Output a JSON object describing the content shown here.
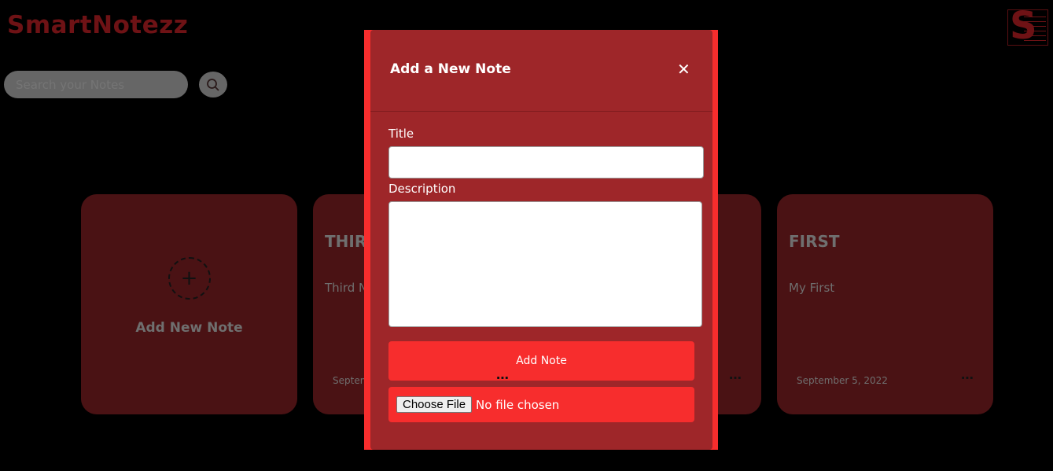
{
  "header": {
    "brand": "SmartNotezz",
    "logo_letter": "S"
  },
  "search": {
    "placeholder": "Search your Notes",
    "icon": "search-icon"
  },
  "add_card": {
    "label": "Add New Note",
    "icon": "plus-icon"
  },
  "notes": [
    {
      "title": "THIR",
      "description": "Third N",
      "date": "Septem",
      "menu": "⋯"
    },
    {
      "menu": "⋯"
    },
    {
      "title": "FIRST",
      "description": "My First",
      "date": "September 5, 2022",
      "menu": "⋯"
    }
  ],
  "modal": {
    "title": "Add a New Note",
    "close": "✕",
    "title_label": "Title",
    "title_value": "",
    "description_label": "Description",
    "description_value": "",
    "submit": "Add Note",
    "file_button": "Choose File",
    "file_status": "No file chosen",
    "overlap_menu": "⋯"
  },
  "colors": {
    "accent": "#f72d2d",
    "panel": "#9e2629",
    "card": "#4a1214",
    "brand": "#6e1215"
  }
}
